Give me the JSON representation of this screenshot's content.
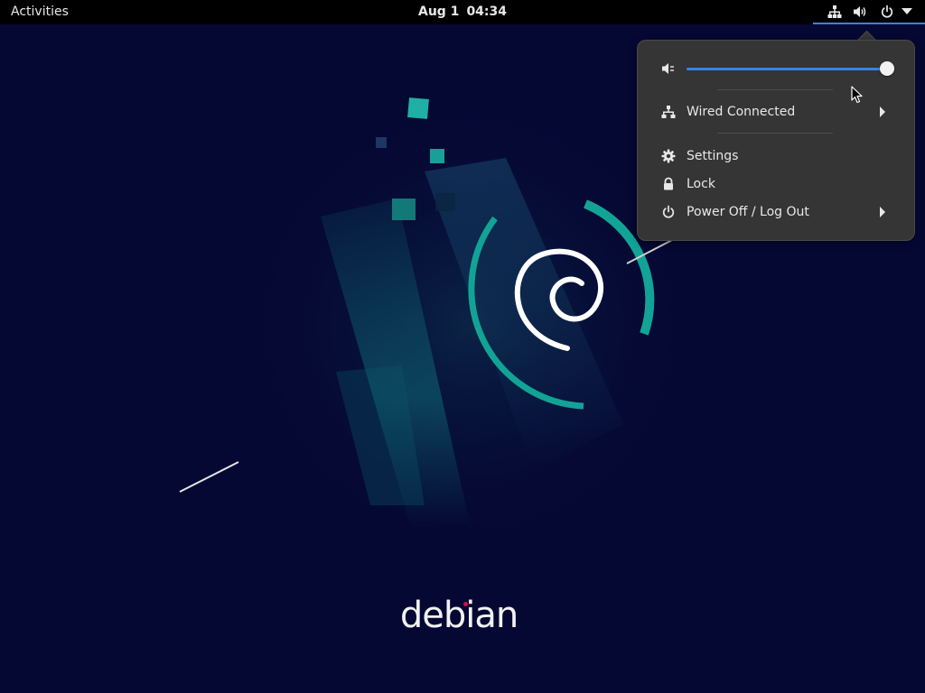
{
  "topbar": {
    "activities_label": "Activities",
    "date": "Aug 1",
    "time": "04:34",
    "tray_icons": [
      "network-wired-icon",
      "speaker-volume-icon",
      "power-icon",
      "dropdown-arrow-icon"
    ]
  },
  "system_menu": {
    "volume": {
      "icon": "speaker-muted-icon",
      "level": 1.0
    },
    "network": {
      "icon": "network-wired-icon",
      "label": "Wired Connected",
      "has_submenu": true
    },
    "items": [
      {
        "icon": "gear-icon",
        "label": "Settings"
      },
      {
        "icon": "lock-icon",
        "label": "Lock"
      },
      {
        "icon": "power-icon",
        "label": "Power Off / Log Out",
        "has_submenu": true
      }
    ]
  },
  "wallpaper": {
    "brand_text": "debian"
  },
  "colors": {
    "background": "#050833",
    "topbar": "#000000",
    "menu_bg": "#353535",
    "accent": "#3584e4",
    "teal": "#12a396",
    "debian_red": "#d70a53"
  }
}
